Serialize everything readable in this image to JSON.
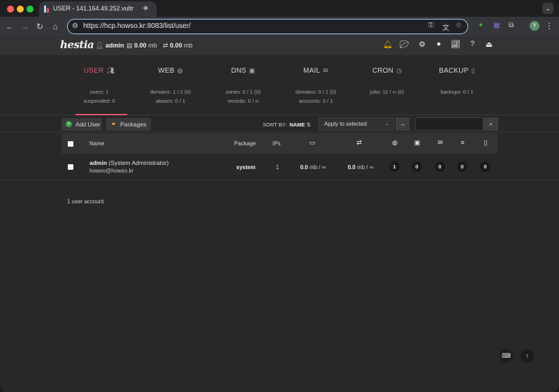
{
  "browser": {
    "tab_title": "USER - 141.164.49.252.vultr",
    "tab_close": "×",
    "new_tab": "+",
    "url": "https://hcp.howso.kr:8083/list/user/",
    "profile_initial": "Y",
    "nav_icons": [
      "back-icon",
      "forward-icon",
      "reload-icon",
      "home-icon"
    ]
  },
  "app": {
    "logo": "hestia",
    "user": "admin",
    "disk": "0.00",
    "disk_unit": "mb",
    "bandwidth": "0.00",
    "bandwidth_unit": "mb",
    "accent_color": "#e0566f",
    "topbar_icons": [
      "notifications-icon",
      "file-manager-icon",
      "server-settings-icon",
      "profile-icon",
      "statistics-icon",
      "help-icon",
      "logout-icon"
    ]
  },
  "stats": [
    {
      "title": "USER",
      "icon": "users-icon",
      "lines": [
        "users: 1",
        "suspended: 0"
      ],
      "active": true
    },
    {
      "title": "WEB",
      "icon": "globe-icon",
      "lines": [
        "domains: 1 / 1 (0)",
        "aliases: 0 / 1"
      ]
    },
    {
      "title": "DNS",
      "icon": "address-book-icon",
      "lines": [
        "zones: 0 / 1 (0)",
        "records: 0 / ∞"
      ]
    },
    {
      "title": "MAIL",
      "icon": "mail-bulk-icon",
      "lines": [
        "domains: 0 / 1 (0)",
        "accounts: 0 / 1"
      ]
    },
    {
      "title": "CRON",
      "icon": "clock-icon",
      "lines": [
        "jobs: 11 / ∞ (0)"
      ]
    },
    {
      "title": "BACKUP",
      "icon": "file-zipper-icon",
      "lines": [
        "backups: 0 / 1"
      ]
    }
  ],
  "actions": {
    "add_user": "Add User",
    "packages": "Packages",
    "sort_label": "SORT BY:",
    "sort_value": "NAME",
    "bulk_select": "Apply to selected",
    "search_placeholder": ""
  },
  "table": {
    "headers": {
      "name": "Name",
      "package": "Package",
      "ips": "IPs"
    },
    "rows": [
      {
        "username": "admin",
        "role": "(System Administrator)",
        "email": "howso@howso.kr",
        "package": "system",
        "ips": "1",
        "disk": "0.0",
        "disk_unit": "mb / ∞",
        "bandwidth": "0.0",
        "bandwidth_unit": "mb / ∞",
        "web": "1",
        "dns": "0",
        "mail": "0",
        "db": "0",
        "backups": "0"
      }
    ]
  },
  "footer": {
    "count": "1 user account"
  }
}
